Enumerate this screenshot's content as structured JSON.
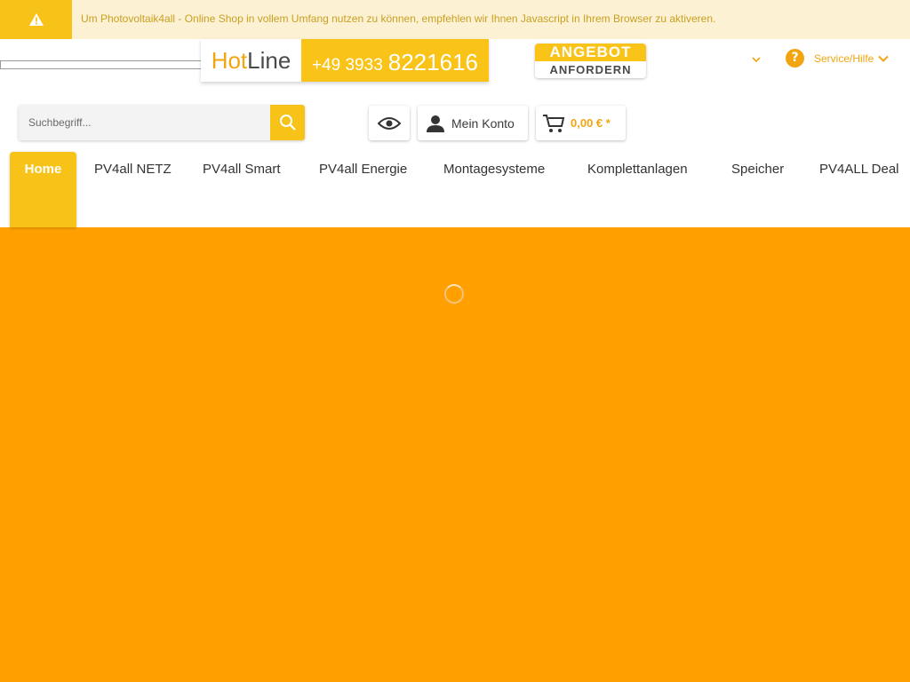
{
  "notice": {
    "icon": "warning-icon",
    "text": "Um Photovoltaik4all - Online Shop in vollem Umfang nutzen zu können, empfehlen wir Ihnen Javascript in Ihrem Browser zu aktiveren."
  },
  "hotline": {
    "label_a": "Hot",
    "label_b": "Line",
    "prefix": "+49 3933",
    "number": "8221616"
  },
  "angebot": {
    "line1": "ANGEBOT",
    "line2": "ANFORDERN"
  },
  "service": {
    "label": "Service/Hilfe",
    "icon": "question-icon"
  },
  "search": {
    "placeholder": "Suchbegriff..."
  },
  "toolbar": {
    "account_label": "Mein Konto",
    "cart_total": "0,00 € *"
  },
  "nav": {
    "items": [
      "Home",
      "PV4all NETZ",
      "PV4all Smart",
      "PV4all Energie",
      "Montagesysteme",
      "Komplettanlagen",
      "Speicher",
      "PV4ALL Deal"
    ]
  },
  "colors": {
    "accent": "#f8c318",
    "orange": "#f3a511",
    "page_bg": "#ffa000",
    "notice_bg": "#fdf1d4"
  }
}
